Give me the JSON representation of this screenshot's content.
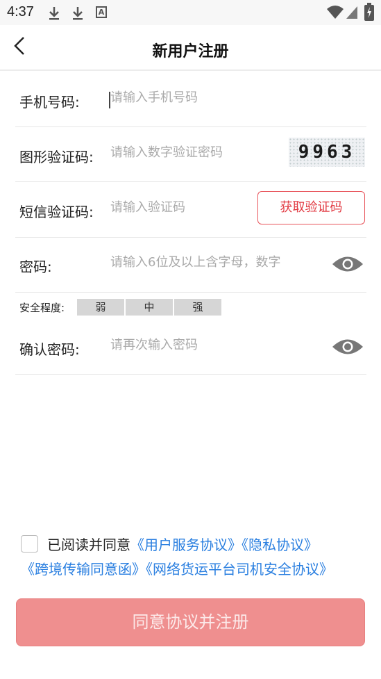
{
  "status_bar": {
    "time": "4:37",
    "left_icons": [
      "download-icon",
      "download-icon",
      "a-badge-icon"
    ],
    "right_icons": [
      "wifi-icon",
      "signal-icon",
      "battery-charging-icon"
    ],
    "badge_letter": "A"
  },
  "header": {
    "title": "新用户注册",
    "back_icon": "chevron-left-icon"
  },
  "form": {
    "phone": {
      "label": "手机号码:",
      "placeholder": "请输入手机号码"
    },
    "captcha": {
      "label": "图形验证码:",
      "placeholder": "请输入数字验证密码",
      "captcha_text": "9963"
    },
    "sms": {
      "label": "短信验证码:",
      "placeholder": "请输入验证码",
      "button_label": "获取验证码"
    },
    "password": {
      "label": "密码:",
      "placeholder": "请输入6位及以上含字母，数字"
    },
    "strength": {
      "label": "安全程度:",
      "levels": [
        "弱",
        "中",
        "强"
      ]
    },
    "confirm": {
      "label": "确认密码:",
      "placeholder": "请再次输入密码"
    }
  },
  "agreement": {
    "prefix": "已阅读并同意",
    "links": [
      "《用户服务协议》",
      "《隐私协议》",
      "《跨境传输同意函》",
      "《网络货运平台司机安全协议》"
    ],
    "checked": false
  },
  "submit": {
    "label": "同意协议并注册"
  },
  "colors": {
    "accent_red": "#e23c44",
    "link_blue": "#2a7fe0",
    "submit_bg": "#ef8f8f"
  }
}
